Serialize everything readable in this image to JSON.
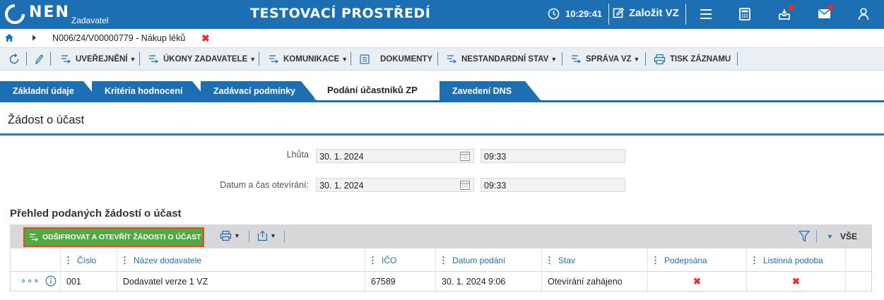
{
  "app": {
    "logo_text": "NEN",
    "logo_sub": "Zadavatel",
    "environment_title": "TESTOVACÍ PROSTŘEDÍ",
    "time": "10:29:41",
    "create_label": "Založit VZ",
    "header_icons": [
      "menu-icon",
      "calculator-icon",
      "inbox-icon",
      "mail-icon",
      "user-icon"
    ],
    "accent_color": "#1d6fb3",
    "notification_color": "#e2312d"
  },
  "breadcrumb": {
    "record_title": "N006/24/V00000779 - Nákup léků",
    "close_symbol": "✖"
  },
  "toolbar": {
    "items": [
      {
        "label": "UVEŘEJNĚNÍ",
        "has_dropdown": true
      },
      {
        "label": "ÚKONY ZADAVATELE",
        "has_dropdown": true
      },
      {
        "label": "KOMUNIKACE",
        "has_dropdown": true
      },
      {
        "label": "DOKUMENTY",
        "has_dropdown": false
      },
      {
        "label": "NESTANDARDNÍ STAV",
        "has_dropdown": true
      },
      {
        "label": "SPRÁVA VZ",
        "has_dropdown": true
      },
      {
        "label": "TISK ZÁZNAMU",
        "has_dropdown": false
      }
    ]
  },
  "tabs": [
    {
      "label": "Základní údaje",
      "active": false
    },
    {
      "label": "Kritéria hodnocení",
      "active": false
    },
    {
      "label": "Zadávací podmínky",
      "active": false
    },
    {
      "label": "Podání účastníků ZP",
      "active": true
    },
    {
      "label": "Zavedení DNS",
      "active": false
    }
  ],
  "section": {
    "title": "Žádost o účast",
    "fields": [
      {
        "label": "Lhůta",
        "date": "30. 1. 2024",
        "time": "09:33"
      },
      {
        "label": "Datum a čas otevírání:",
        "date": "30. 1. 2024",
        "time": "09:33"
      }
    ]
  },
  "overview": {
    "title": "Přehled podaných žádostí o účast",
    "decrypt_button": "ODŠIFROVAT A OTEVŘÍT ŽÁDOSTI O ÚČAST",
    "filter_all": "VŠE",
    "columns": [
      "Číslo",
      "Název dodavatele",
      "IČO",
      "Datum podání",
      "Stav",
      "Podepsána",
      "Listinná podoba"
    ],
    "rows": [
      {
        "cislo": "001",
        "nazev": "Dodavatel verze 1 VZ",
        "ico": "67589",
        "datum": "30. 1. 2024 9:06",
        "stav": "Otevírání zahájeno",
        "podepsana": "✖",
        "listinna": "✖"
      }
    ]
  }
}
